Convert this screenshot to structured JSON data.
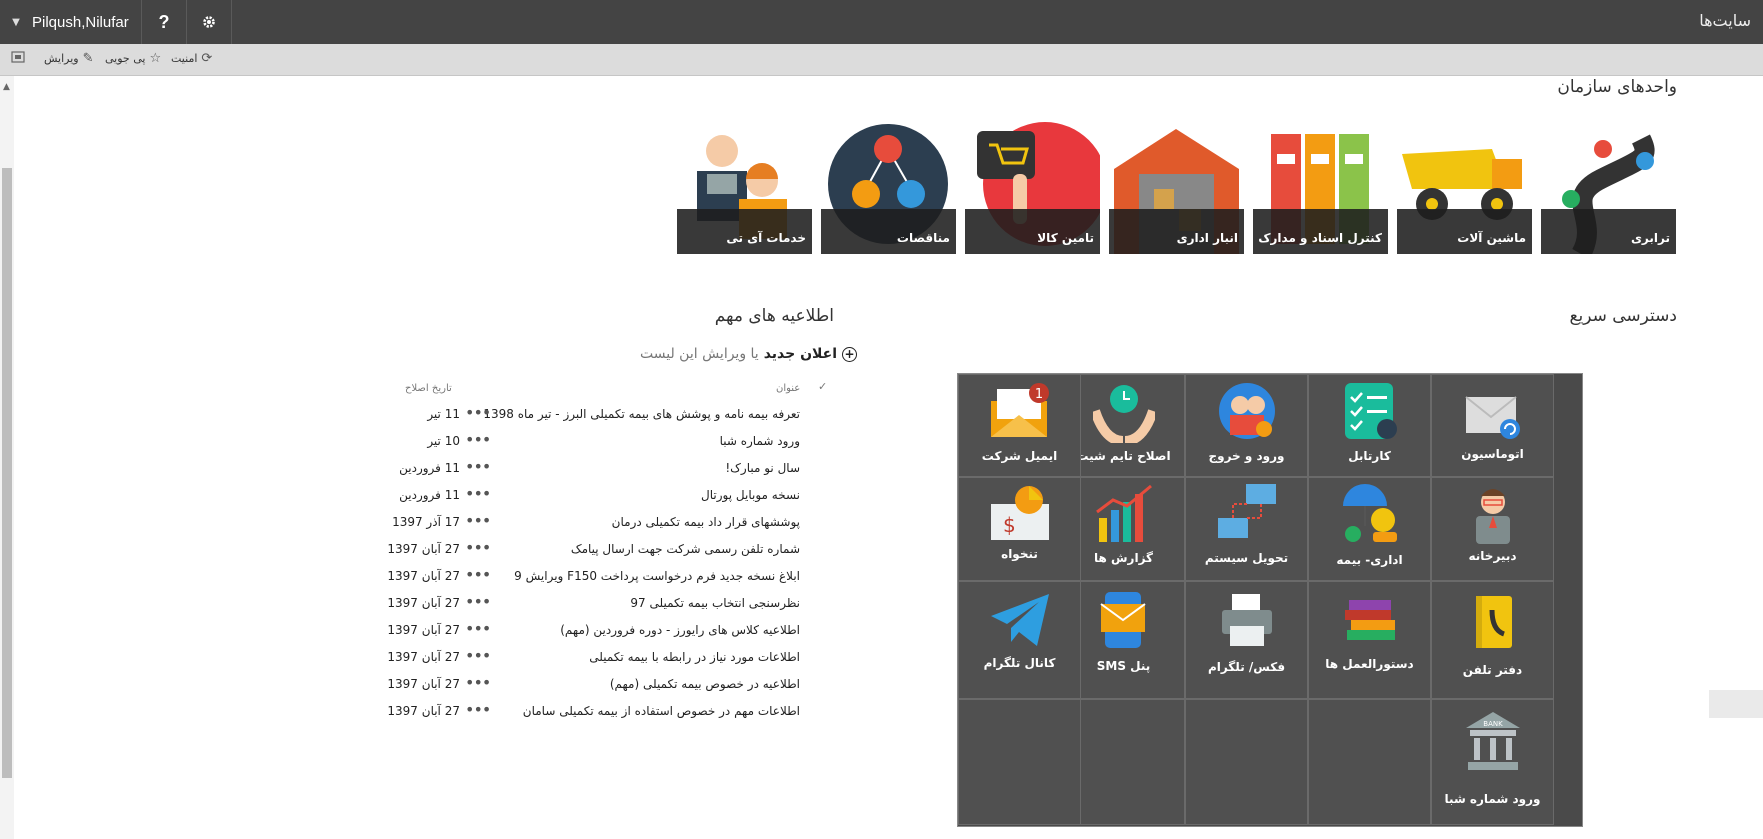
{
  "topbar": {
    "user_name": "Pilqush,Nilufar",
    "help_label": "?",
    "sites_label": "سایت‌ها"
  },
  "subbar": {
    "security_label": "امنیت",
    "follow_label": "پی جویی",
    "edit_label": "ویرایش"
  },
  "org_units": {
    "title": "واحدهای سازمان",
    "tiles": [
      {
        "label": "ترابری"
      },
      {
        "label": "ماشین آلات"
      },
      {
        "label": "کنترل اسناد و مدارک"
      },
      {
        "label": "انبار اداری"
      },
      {
        "label": "تامین کالا"
      },
      {
        "label": "مناقصات"
      },
      {
        "label": "خدمات آی تی"
      }
    ]
  },
  "announcements": {
    "title": "اطلاعیه های مهم",
    "new_label": "اعلان جدید",
    "or_edit_label": "یا ویرایش این لیست",
    "check_mark": "✓",
    "col_title": "عنوان",
    "col_modified": "تاریخ اصلاح",
    "more_label": "•••",
    "rows": [
      {
        "title": "تعرفه بیمه نامه و پوشش های بیمه تکمیلی البرز - تیر ماه 1398",
        "date": "11 تیر"
      },
      {
        "title": "ورود شماره شبا",
        "date": "10 تیر"
      },
      {
        "title": "سال نو مبارک!",
        "date": "11 فروردین"
      },
      {
        "title": "نسخه موبایل پورتال",
        "date": "11 فروردین"
      },
      {
        "title": "پوششهای قرار داد بیمه تکمیلی درمان",
        "date": "17 آذر 1397"
      },
      {
        "title": "شماره تلفن رسمی شرکت جهت ارسال پیامک",
        "date": "27 آبان 1397"
      },
      {
        "title": "ابلاغ نسخه جدید فرم درخواست پرداخت F150 ویرایش 9",
        "date": "27 آبان 1397"
      },
      {
        "title": "نظرسنجی انتخاب بیمه تکمیلی 97",
        "date": "27 آبان 1397"
      },
      {
        "title": "اطلاعیه کلاس های رایورز - دوره فروردین (مهم)",
        "date": "27 آبان 1397"
      },
      {
        "title": "اطلاعات مورد نیاز در رابطه با بیمه تکمیلی",
        "date": "27 آبان 1397"
      },
      {
        "title": "اطلاعیه در خصوص بیمه تکمیلی (مهم)",
        "date": "27 آبان 1397"
      },
      {
        "title": "اطلاعات مهم در خصوص استفاده از بیمه تکمیلی سامان",
        "date": "27 آبان 1397"
      }
    ]
  },
  "quick_access": {
    "title": "دسترسی سریع",
    "items": [
      {
        "label": "اتوماسیون",
        "icon": "envelope-sync-icon"
      },
      {
        "label": "کارتابل",
        "icon": "checklist-icon"
      },
      {
        "label": "ورود و خروج",
        "icon": "people-clock-icon"
      },
      {
        "label": "اصلاح تایم شیت",
        "icon": "hands-clock-icon"
      },
      {
        "label": "ایمیل شرکت",
        "icon": "mail-badge-icon",
        "badge": "1"
      },
      {
        "label": "دبیرخانه",
        "icon": "clerk-icon"
      },
      {
        "label": "اداری- بیمه",
        "icon": "umbrella-coins-icon"
      },
      {
        "label": "تحویل سیستم",
        "icon": "computers-icon"
      },
      {
        "label": "گزارش ها",
        "icon": "bar-chart-icon"
      },
      {
        "label": "تنخواه",
        "icon": "petty-cash-icon"
      },
      {
        "label": "دفتر تلفن",
        "icon": "phone-book-icon"
      },
      {
        "label": "دستورالعمل ها",
        "icon": "books-icon"
      },
      {
        "label": "فکس/ تلگرام",
        "icon": "fax-icon"
      },
      {
        "label": "پنل SMS",
        "icon": "sms-phone-icon"
      },
      {
        "label": "کانال تلگرام",
        "icon": "telegram-icon"
      },
      {
        "label": "ورود شماره شبا",
        "icon": "bank-icon",
        "bank_text": "BANK"
      }
    ]
  }
}
